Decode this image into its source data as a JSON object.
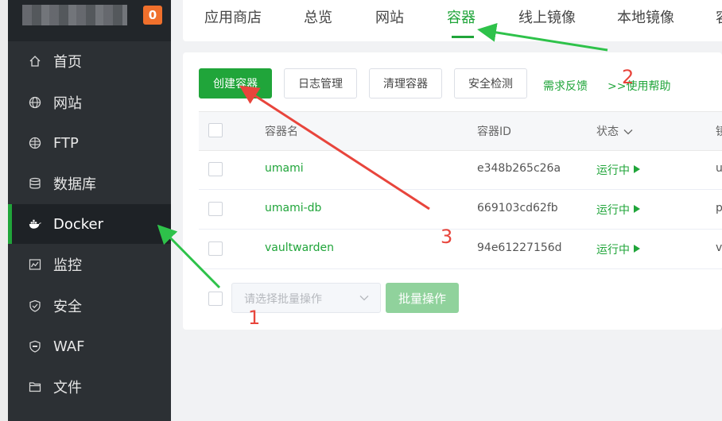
{
  "sidebar": {
    "badge": "0",
    "items": [
      {
        "icon": "home-icon",
        "label": "首页"
      },
      {
        "icon": "globe-icon",
        "label": "网站"
      },
      {
        "icon": "ftp-globe-icon",
        "label": "FTP"
      },
      {
        "icon": "database-icon",
        "label": "数据库"
      },
      {
        "icon": "docker-icon",
        "label": "Docker",
        "active": true
      },
      {
        "icon": "monitor-chart-icon",
        "label": "监控"
      },
      {
        "icon": "shield-check-icon",
        "label": "安全"
      },
      {
        "icon": "waf-shield-icon",
        "label": "WAF"
      },
      {
        "icon": "folder-icon",
        "label": "文件"
      }
    ]
  },
  "tabs": [
    "应用商店",
    "总览",
    "网站",
    "容器",
    "线上镜像",
    "本地镜像",
    "容"
  ],
  "active_tab": "容器",
  "toolbar": {
    "create_label": "创建容器",
    "log_label": "日志管理",
    "clean_label": "清理容器",
    "security_label": "安全检测",
    "feedback_link": "需求反馈",
    "help_link": ">>使用帮助"
  },
  "table": {
    "headers": [
      "容器名",
      "容器ID",
      "状态",
      "镜"
    ],
    "rows": [
      {
        "name": "umami",
        "id": "e348b265c26a",
        "status": "运行中",
        "extra": "u"
      },
      {
        "name": "umami-db",
        "id": "669103cd62fb",
        "status": "运行中",
        "extra": "p"
      },
      {
        "name": "vaultwarden",
        "id": "94e61227156d",
        "status": "运行中",
        "extra": "v"
      }
    ]
  },
  "batch": {
    "select_placeholder": "请选择批量操作",
    "button_label": "批量操作"
  },
  "annotations": {
    "label_1": "1",
    "label_2": "2",
    "label_3": "3",
    "green": "#2ec24a",
    "red": "#e8453c"
  },
  "colors": {
    "accent": "#20a53a",
    "sidebar_bg": "#2c3034",
    "badge": "#f0702c"
  }
}
